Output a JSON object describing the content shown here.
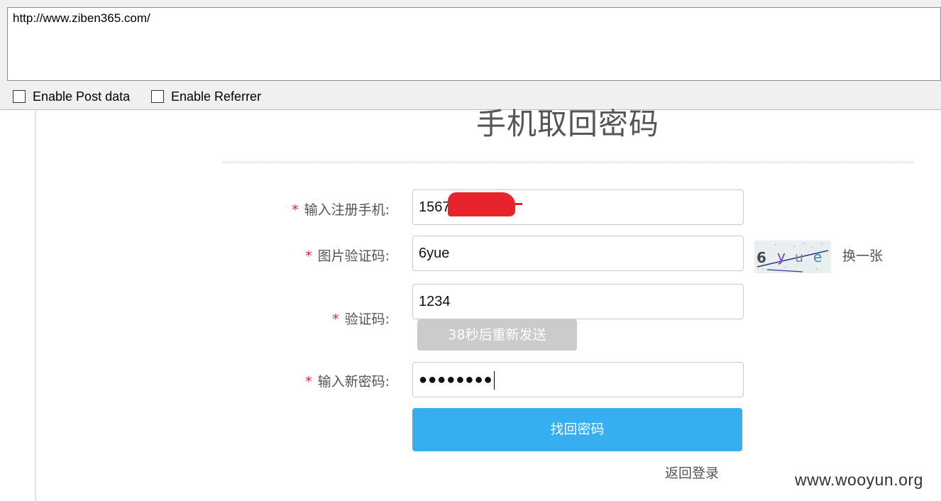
{
  "toolbar": {
    "url": "http://www.ziben365.com/",
    "enable_post_label": "Enable Post data",
    "enable_referrer_label": "Enable Referrer",
    "enable_post_checked": false,
    "enable_referrer_checked": false
  },
  "form": {
    "title": "手机取回密码",
    "required_mark": "*",
    "phone": {
      "label": "输入注册手机:",
      "value": "1567"
    },
    "image_code": {
      "label": "图片验证码:",
      "value": "6yue",
      "captcha_text": "6yue",
      "refresh_label": "换一张"
    },
    "sms_code": {
      "label": "验证码:",
      "value": "1234",
      "resend_label": "38秒后重新发送"
    },
    "new_password": {
      "label": "输入新密码:",
      "masked_value": "●●●●●●●●"
    },
    "submit_label": "找回密码",
    "back_label": "返回登录"
  },
  "watermark": "www.wooyun.org",
  "colors": {
    "accent": "#37aeef",
    "required": "#d9262b",
    "disabled_button": "#cbcbcb",
    "redaction": "#e8232b"
  }
}
